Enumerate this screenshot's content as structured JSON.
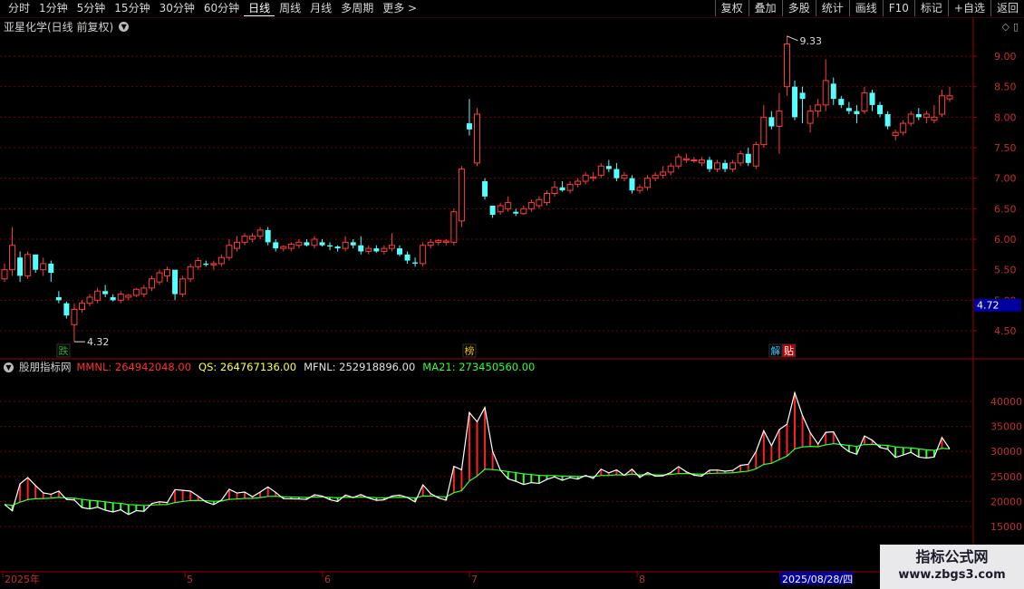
{
  "toolbar": {
    "left": [
      "分时",
      "1分钟",
      "5分钟",
      "15分钟",
      "30分钟",
      "60分钟",
      "日线",
      "周线",
      "月线",
      "多周期",
      "更多 >"
    ],
    "active_index": 6,
    "right": [
      "复权",
      "叠加",
      "多股",
      "统计",
      "画线",
      "F10",
      "标记",
      "+自选",
      "返回"
    ]
  },
  "stock": {
    "title": "亚星化学(日线 前复权)"
  },
  "price_axis": {
    "labels": [
      "9.00",
      "8.50",
      "8.00",
      "7.50",
      "7.00",
      "6.50",
      "6.00",
      "5.50",
      "5.00",
      "4.50"
    ],
    "current": "4.72"
  },
  "annotations": {
    "high": "9.33",
    "low": "4.32"
  },
  "markers": [
    {
      "text": "跌",
      "color": "#28b028",
      "bg": "#000"
    },
    {
      "text": "榜",
      "color": "#e8c000",
      "bg": "#000"
    },
    {
      "text": "解",
      "color": "#30c8ff",
      "bg": "#000"
    },
    {
      "text": "贴",
      "color": "#ffffff",
      "bg": "#c00000"
    }
  ],
  "indicator": {
    "name": "股朋指标网",
    "fields": [
      {
        "label": "MMNL: 264942048.00",
        "color": "#ff3030"
      },
      {
        "label": "QS: 264767136.00",
        "color": "#ffff40"
      },
      {
        "label": "MFNL: 252918896.00",
        "color": "#e0e0e0"
      },
      {
        "label": "MA21: 273450560.00",
        "color": "#30ff30"
      }
    ],
    "axis_labels": [
      "40000",
      "35000",
      "30000",
      "25000",
      "20000",
      "15000"
    ]
  },
  "x_axis": {
    "labels": [
      "2025年",
      "5",
      "6",
      "7",
      "8",
      "2025/08/28/四"
    ]
  },
  "watermark": {
    "line1": "指标公式网",
    "line2": "www.zbgs3.com"
  },
  "chart_data": {
    "type": "candlestick",
    "title": "亚星化学(日线 前复权)",
    "ylim": [
      4.2,
      9.5
    ],
    "high_label": 9.33,
    "low_label": 4.32,
    "candles": [
      [
        5.35,
        5.6,
        5.3,
        5.5
      ],
      [
        5.5,
        6.2,
        5.4,
        5.9
      ],
      [
        5.7,
        5.8,
        5.3,
        5.4
      ],
      [
        5.4,
        5.8,
        5.35,
        5.75
      ],
      [
        5.75,
        5.75,
        5.45,
        5.5
      ],
      [
        5.5,
        5.7,
        5.4,
        5.6
      ],
      [
        5.6,
        5.65,
        5.3,
        5.45
      ],
      [
        5.05,
        5.15,
        4.95,
        5.0
      ],
      [
        4.95,
        4.98,
        4.7,
        4.75
      ],
      [
        4.6,
        4.95,
        4.32,
        4.85
      ],
      [
        4.85,
        5.0,
        4.8,
        4.95
      ],
      [
        4.95,
        5.1,
        4.9,
        5.05
      ],
      [
        5.0,
        5.2,
        4.95,
        5.15
      ],
      [
        5.15,
        5.25,
        5.05,
        5.1
      ],
      [
        5.05,
        5.1,
        4.98,
        5.0
      ],
      [
        5.0,
        5.15,
        4.95,
        5.1
      ],
      [
        5.05,
        5.1,
        5.0,
        5.08
      ],
      [
        5.08,
        5.2,
        5.05,
        5.18
      ],
      [
        5.1,
        5.25,
        5.05,
        5.2
      ],
      [
        5.2,
        5.4,
        5.15,
        5.35
      ],
      [
        5.3,
        5.5,
        5.25,
        5.45
      ],
      [
        5.4,
        5.55,
        5.3,
        5.5
      ],
      [
        5.5,
        5.45,
        5.0,
        5.1
      ],
      [
        5.1,
        5.4,
        5.05,
        5.35
      ],
      [
        5.35,
        5.6,
        5.3,
        5.55
      ],
      [
        5.55,
        5.7,
        5.5,
        5.65
      ],
      [
        5.6,
        5.65,
        5.55,
        5.58
      ],
      [
        5.58,
        5.65,
        5.5,
        5.6
      ],
      [
        5.6,
        5.75,
        5.55,
        5.7
      ],
      [
        5.7,
        6.0,
        5.65,
        5.9
      ],
      [
        5.85,
        6.05,
        5.8,
        5.95
      ],
      [
        5.95,
        6.1,
        5.9,
        6.05
      ],
      [
        6.0,
        6.1,
        5.95,
        6.05
      ],
      [
        6.05,
        6.2,
        6.0,
        6.15
      ],
      [
        6.15,
        6.2,
        5.9,
        5.95
      ],
      [
        5.95,
        6.0,
        5.8,
        5.85
      ],
      [
        5.85,
        5.9,
        5.8,
        5.88
      ],
      [
        5.85,
        5.95,
        5.8,
        5.92
      ],
      [
        5.9,
        6.0,
        5.85,
        5.95
      ],
      [
        5.95,
        6.0,
        5.88,
        5.9
      ],
      [
        5.9,
        6.05,
        5.85,
        6.0
      ],
      [
        5.95,
        6.0,
        5.88,
        5.9
      ],
      [
        5.9,
        5.95,
        5.82,
        5.88
      ],
      [
        5.88,
        5.9,
        5.8,
        5.85
      ],
      [
        5.85,
        6.05,
        5.8,
        5.95
      ],
      [
        5.95,
        6.0,
        5.85,
        5.9
      ],
      [
        5.9,
        6.05,
        5.75,
        5.8
      ],
      [
        5.8,
        5.9,
        5.75,
        5.85
      ],
      [
        5.85,
        5.9,
        5.78,
        5.8
      ],
      [
        5.8,
        5.9,
        5.75,
        5.85
      ],
      [
        5.85,
        6.1,
        5.8,
        5.9
      ],
      [
        5.85,
        5.9,
        5.72,
        5.75
      ],
      [
        5.75,
        5.8,
        5.6,
        5.65
      ],
      [
        5.62,
        5.7,
        5.55,
        5.6
      ],
      [
        5.6,
        5.95,
        5.55,
        5.9
      ],
      [
        5.9,
        6.0,
        5.85,
        5.95
      ],
      [
        5.95,
        6.0,
        5.9,
        5.98
      ],
      [
        5.95,
        6.0,
        5.9,
        5.97
      ],
      [
        5.95,
        6.5,
        5.9,
        6.45
      ],
      [
        6.3,
        7.2,
        6.2,
        7.15
      ],
      [
        7.9,
        8.3,
        7.7,
        7.8
      ],
      [
        7.25,
        8.15,
        7.2,
        8.05
      ],
      [
        6.95,
        7.0,
        6.65,
        6.7
      ],
      [
        6.55,
        6.55,
        6.35,
        6.4
      ],
      [
        6.45,
        6.6,
        6.4,
        6.55
      ],
      [
        6.5,
        6.7,
        6.45,
        6.6
      ],
      [
        6.45,
        6.5,
        6.38,
        6.42
      ],
      [
        6.42,
        6.55,
        6.4,
        6.5
      ],
      [
        6.5,
        6.65,
        6.45,
        6.6
      ],
      [
        6.55,
        6.7,
        6.5,
        6.65
      ],
      [
        6.6,
        6.8,
        6.55,
        6.75
      ],
      [
        6.75,
        6.95,
        6.7,
        6.85
      ],
      [
        6.85,
        6.95,
        6.78,
        6.8
      ],
      [
        6.8,
        6.95,
        6.75,
        6.9
      ],
      [
        6.9,
        7.0,
        6.85,
        6.95
      ],
      [
        6.95,
        7.1,
        6.9,
        7.05
      ],
      [
        7.0,
        7.1,
        6.95,
        7.02
      ],
      [
        7.05,
        7.25,
        7.0,
        7.2
      ],
      [
        7.2,
        7.3,
        7.1,
        7.15
      ],
      [
        7.15,
        7.25,
        6.95,
        7.0
      ],
      [
        7.0,
        7.1,
        6.95,
        7.05
      ],
      [
        7.0,
        7.05,
        6.75,
        6.8
      ],
      [
        6.8,
        6.9,
        6.75,
        6.85
      ],
      [
        6.85,
        7.05,
        6.8,
        7.0
      ],
      [
        7.0,
        7.1,
        6.95,
        7.05
      ],
      [
        7.05,
        7.2,
        7.0,
        7.1
      ],
      [
        7.1,
        7.25,
        7.05,
        7.2
      ],
      [
        7.2,
        7.4,
        7.15,
        7.35
      ],
      [
        7.3,
        7.4,
        7.25,
        7.32
      ],
      [
        7.3,
        7.35,
        7.25,
        7.3
      ],
      [
        7.25,
        7.35,
        7.2,
        7.3
      ],
      [
        7.3,
        7.35,
        7.1,
        7.15
      ],
      [
        7.15,
        7.3,
        7.1,
        7.25
      ],
      [
        7.25,
        7.3,
        7.1,
        7.15
      ],
      [
        7.15,
        7.3,
        7.1,
        7.25
      ],
      [
        7.25,
        7.45,
        7.2,
        7.4
      ],
      [
        7.4,
        7.5,
        7.2,
        7.25
      ],
      [
        7.2,
        7.6,
        7.15,
        7.55
      ],
      [
        7.55,
        8.2,
        7.5,
        8.0
      ],
      [
        8.0,
        8.1,
        7.8,
        7.85
      ],
      [
        7.85,
        8.4,
        7.4,
        8.1
      ],
      [
        8.5,
        9.33,
        8.35,
        9.2
      ],
      [
        8.5,
        8.6,
        7.95,
        8.0
      ],
      [
        8.4,
        8.5,
        7.9,
        8.3
      ],
      [
        7.9,
        8.2,
        7.75,
        8.1
      ],
      [
        8.1,
        8.3,
        8.0,
        8.2
      ],
      [
        8.2,
        8.95,
        8.1,
        8.6
      ],
      [
        8.55,
        8.65,
        8.2,
        8.3
      ],
      [
        8.3,
        8.35,
        8.15,
        8.2
      ],
      [
        8.15,
        8.25,
        8.05,
        8.1
      ],
      [
        8.1,
        8.2,
        7.9,
        8.05
      ],
      [
        8.1,
        8.5,
        8.05,
        8.4
      ],
      [
        8.4,
        8.45,
        8.1,
        8.2
      ],
      [
        8.2,
        8.25,
        8.0,
        8.05
      ],
      [
        8.05,
        8.1,
        7.8,
        7.85
      ],
      [
        7.7,
        7.8,
        7.62,
        7.75
      ],
      [
        7.75,
        7.95,
        7.7,
        7.9
      ],
      [
        7.9,
        8.1,
        7.85,
        8.05
      ],
      [
        8.05,
        8.15,
        7.95,
        8.0
      ],
      [
        8.0,
        8.1,
        7.9,
        8.05
      ],
      [
        7.95,
        8.2,
        7.9,
        8.0
      ],
      [
        8.05,
        8.45,
        8.0,
        8.35
      ],
      [
        8.3,
        8.5,
        8.25,
        8.35
      ]
    ]
  }
}
